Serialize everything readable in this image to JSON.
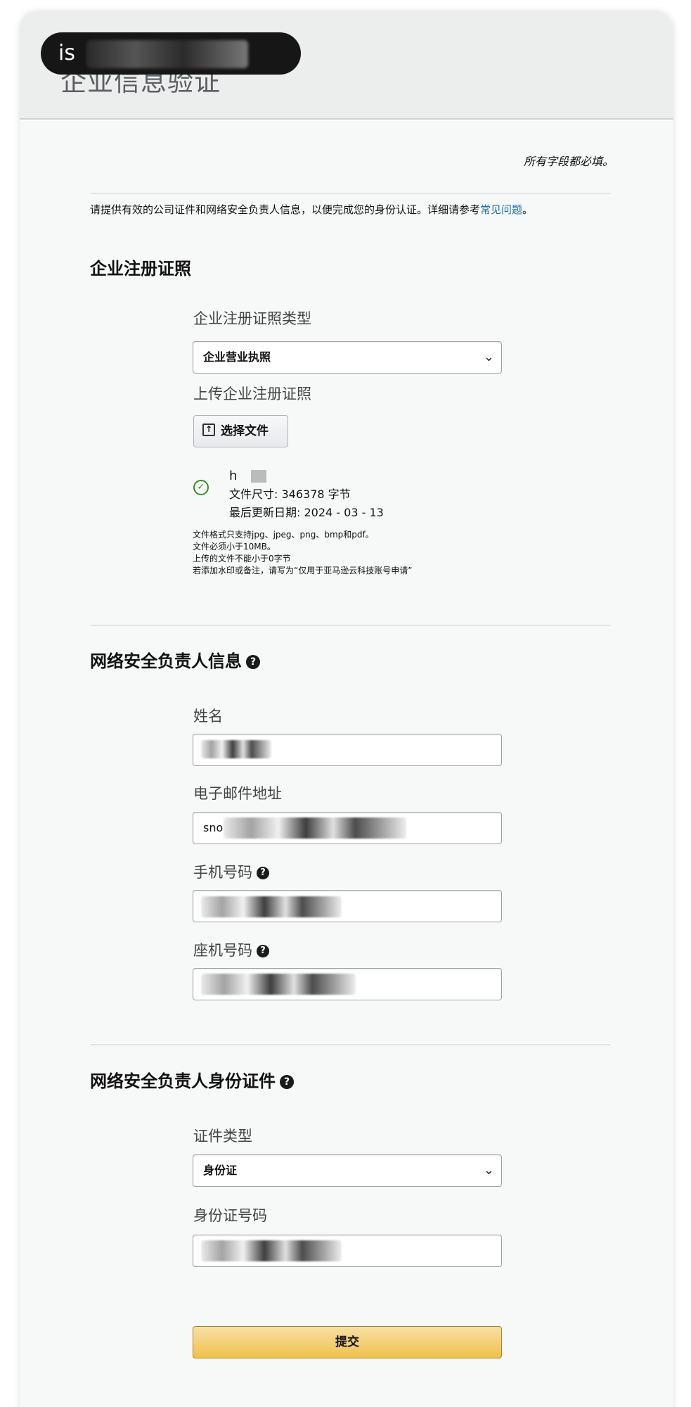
{
  "header": {
    "title": "企业信息验证",
    "pill_text": "is"
  },
  "required_note": "所有字段都必填。",
  "intro": {
    "text": "请提供有效的公司证件和网络安全负责人信息，以便完成您的身份认证。详细请参考",
    "link": "常见问题",
    "end": "。"
  },
  "sections": {
    "registration": {
      "title": "企业注册证照",
      "type_label": "企业注册证照类型",
      "type_value": "企业营业执照",
      "upload_label": "上传企业注册证照",
      "choose_file": "选择文件",
      "file": {
        "name": "h",
        "size_line": "文件尺寸: 346378 字节",
        "date_line": "最后更新日期: 2024 - 03 - 13"
      },
      "hints": [
        "文件格式只支持jpg、jpeg、png、bmp和pdf。",
        "文件必须小于10MB。",
        "上传的文件不能小于0字节",
        "若添加水印或备注，请写为“仅用于亚马逊云科技账号申请”"
      ]
    },
    "contact": {
      "title": "网络安全负责人信息",
      "name_label": "姓名",
      "email_label": "电子邮件地址",
      "email_value": "sno",
      "mobile_label": "手机号码",
      "landline_label": "座机号码"
    },
    "identity": {
      "title": "网络安全负责人身份证件",
      "doc_type_label": "证件类型",
      "doc_type_value": "身份证",
      "id_number_label": "身份证号码"
    }
  },
  "submit_label": "提交",
  "colors": {
    "link": "#1e6fb0",
    "submit_button": "#f0c14b",
    "success_check": "#3a8c2a",
    "header_bg": "#eceded"
  }
}
